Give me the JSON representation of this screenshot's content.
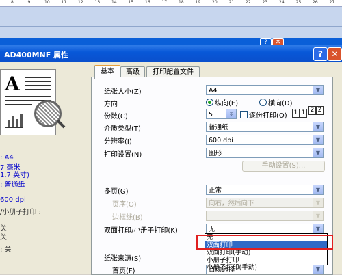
{
  "ruler": {
    "ticks": [
      "8",
      "9",
      "10",
      "11",
      "12",
      "13",
      "14",
      "15",
      "16",
      "17",
      "18",
      "19",
      "20",
      "21",
      "22",
      "23",
      "24",
      "25",
      "26",
      "27"
    ]
  },
  "background_window": {
    "help": "?",
    "close": "✕"
  },
  "dialog": {
    "title": "AD400MNF 属性",
    "help_label": "?",
    "close_label": "✕",
    "preview": {
      "glyph": "A"
    },
    "summary": {
      "line1": ": A4",
      "line2": "7 毫米",
      "line3": "1.7 英寸)",
      "line4": ": 普通纸",
      "line5": "600 dpi",
      "line6": "/小册子打印 :",
      "line7": "关",
      "line8": "关",
      "line9": ": 关"
    },
    "tabs": [
      "基本",
      "高级",
      "打印配置文件"
    ],
    "fields": {
      "paper_size": {
        "label": "纸张大小(Z)",
        "value": "A4"
      },
      "orientation": {
        "label": "方向",
        "portrait": "纵向(E)",
        "landscape": "横向(D)"
      },
      "copies": {
        "label": "份数(C)",
        "value": "5",
        "collate": "逐份打印(O)"
      },
      "media_type": {
        "label": "介质类型(T)",
        "value": "普通纸"
      },
      "resolution": {
        "label": "分辨率(I)",
        "value": "600 dpi"
      },
      "print_settings": {
        "label": "打印设置(N)",
        "value": "图形"
      },
      "manual_settings": "手动设置(S)...",
      "multi_page": {
        "label": "多页(G)",
        "value": "正常"
      },
      "page_order": {
        "label": "页序(O)",
        "value": "向右，然后向下"
      },
      "border_line": {
        "label": "边框线(B)",
        "value": ""
      },
      "duplex": {
        "label": "双面打印/小册子打印(K)",
        "value": "无"
      },
      "paper_source": {
        "label": "纸张来源(S)"
      },
      "first_page": {
        "label": "首页(F)",
        "value": "自动选择"
      }
    },
    "duplex_options": [
      "无",
      "双面打印",
      "双面打印(手动)",
      "小册子打印",
      "小册子打印(手动)"
    ]
  }
}
